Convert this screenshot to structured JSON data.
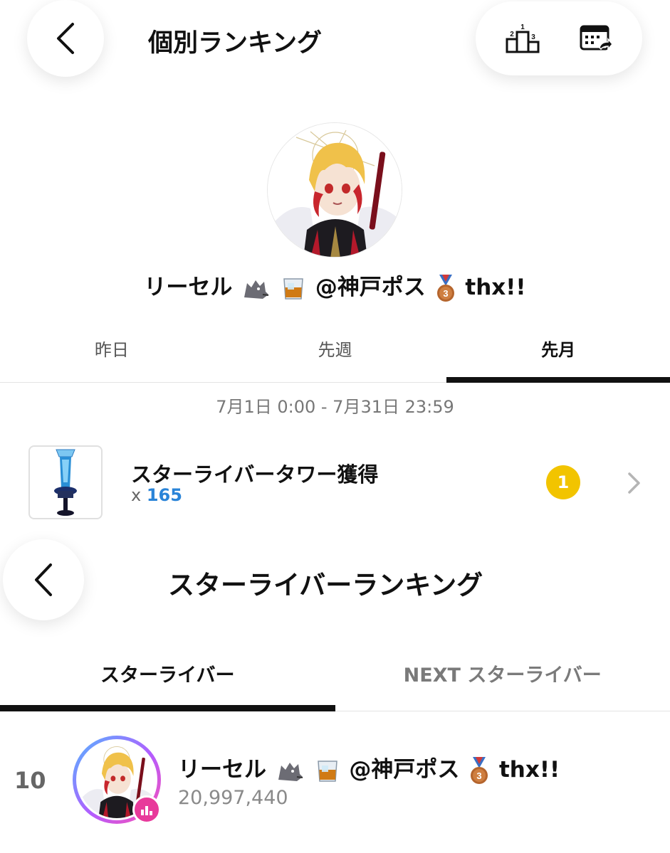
{
  "header": {
    "title": "個別ランキング",
    "icons": [
      "back-icon",
      "podium-icon",
      "calendar-share-icon"
    ]
  },
  "profile": {
    "name_part1": "リーセル",
    "name_part2": "@神戸ポス",
    "name_part3": "thx!!",
    "emojis": [
      "wolf-emoji",
      "whisky-glass-emoji",
      "bronze-medal-emoji"
    ]
  },
  "period_tabs": [
    {
      "label": "昨日",
      "active": false
    },
    {
      "label": "先週",
      "active": false
    },
    {
      "label": "先月",
      "active": true
    }
  ],
  "date_range": "7月1日 0:00 - 7月31日 23:59",
  "item": {
    "name": "スターライバータワー獲得",
    "count_prefix": "x",
    "count": "165",
    "rank": "1"
  },
  "sub_header": {
    "title": "スターライバーランキング"
  },
  "rank_tabs": [
    {
      "label": "スターライバー",
      "active": true
    },
    {
      "label": "NEXT スターライバー",
      "active": false
    }
  ],
  "ranking_entry": {
    "rank": "10",
    "name_part1": "リーセル",
    "name_part2": "@神戸ポス",
    "name_part3": "thx!!",
    "score": "20,997,440"
  },
  "colors": {
    "accent_blue": "#2a84d8",
    "rank_gold": "#f2c400",
    "badge_pink": "#e83a9b"
  }
}
